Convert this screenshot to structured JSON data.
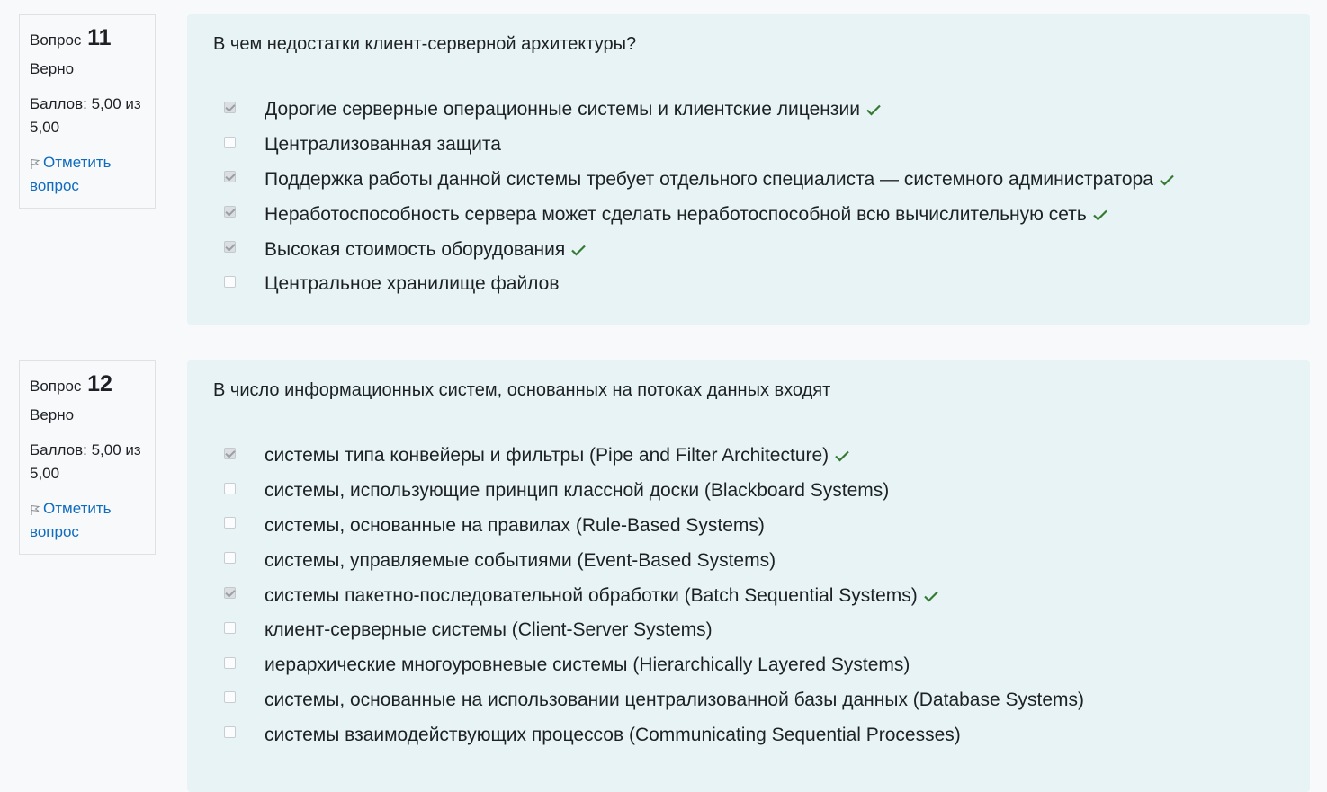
{
  "questions": [
    {
      "prefix": "Вопрос",
      "number": "11",
      "state": "Верно",
      "grade": "Баллов: 5,00 из 5,00",
      "flag_label": "Отметить вопрос",
      "text": "В чем недостатки клиент-серверной архитектуры?",
      "answers": [
        {
          "label": "Дорогие серверные операционные системы и клиентские лицензии",
          "checked": true,
          "correct_mark": true
        },
        {
          "label": "Централизованная защита",
          "checked": false,
          "correct_mark": false
        },
        {
          "label": "Поддержка работы данной системы требует отдельного специалиста — системного администратора",
          "checked": true,
          "correct_mark": true
        },
        {
          "label": "Неработоспособность сервера может сделать неработоспособной всю вычислительную сеть",
          "checked": true,
          "correct_mark": true
        },
        {
          "label": "Высокая стоимость оборудования",
          "checked": true,
          "correct_mark": true
        },
        {
          "label": "Центральное хранилище файлов",
          "checked": false,
          "correct_mark": false
        }
      ]
    },
    {
      "prefix": "Вопрос",
      "number": "12",
      "state": "Верно",
      "grade": "Баллов: 5,00 из 5,00",
      "flag_label": "Отметить вопрос",
      "text": "В число информационных систем, основанных на потоках данных входят",
      "answers": [
        {
          "label": "системы типа конвейеры и фильтры (Pipe and Filter Architecture)",
          "checked": true,
          "correct_mark": true
        },
        {
          "label": "системы, использующие принцип классной доски (Blackboard Systems)",
          "checked": false,
          "correct_mark": false
        },
        {
          "label": "системы, основанные на правилах (Rule-Based Systems)",
          "checked": false,
          "correct_mark": false
        },
        {
          "label": "системы, управляемые событиями (Event-Based Systems)",
          "checked": false,
          "correct_mark": false
        },
        {
          "label": "системы пакетно-последовательной обработки (Batch Sequential Systems)",
          "checked": true,
          "correct_mark": true
        },
        {
          "label": "клиент-серверные системы (Client-Server Systems)",
          "checked": false,
          "correct_mark": false
        },
        {
          "label": "иерархические многоуровневые системы (Hierarchically Layered Systems)",
          "checked": false,
          "correct_mark": false
        },
        {
          "label": "системы, основанные на использовании централизованной базы данных (Database Systems)",
          "checked": false,
          "correct_mark": false
        },
        {
          "label": "системы взаимодействующих процессов (Communicating Sequential Processes)",
          "checked": false,
          "correct_mark": false
        }
      ]
    }
  ],
  "icons": {
    "flag": "flag-icon",
    "correct": "check-icon"
  },
  "colors": {
    "link": "#0f6cbf",
    "correct": "#357a32",
    "content_bg": "#e7f3f5"
  }
}
